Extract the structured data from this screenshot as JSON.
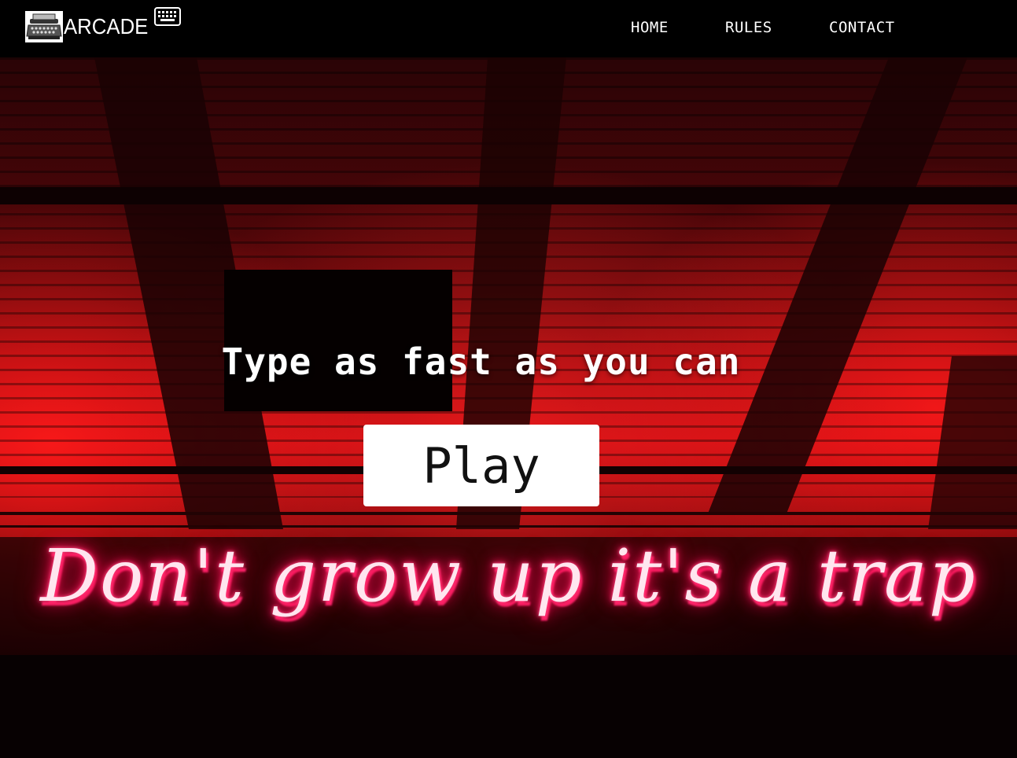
{
  "navbar": {
    "brand_label": "ARCADE",
    "logo_icon": "typewriter-icon",
    "brand_icon": "keyboard-icon",
    "links": [
      {
        "label": "HOME"
      },
      {
        "label": "RULES"
      },
      {
        "label": "CONTACT"
      }
    ]
  },
  "hero": {
    "headline": "Type as fast as you can",
    "play_label": "Play",
    "neon_sign_text": "Don't grow up it's a trap"
  },
  "colors": {
    "navbar_bg": "#000000",
    "neon_red": "#ff1f3a",
    "neon_pink": "#ff4d86",
    "button_bg": "#ffffff",
    "text": "#ffffff"
  }
}
